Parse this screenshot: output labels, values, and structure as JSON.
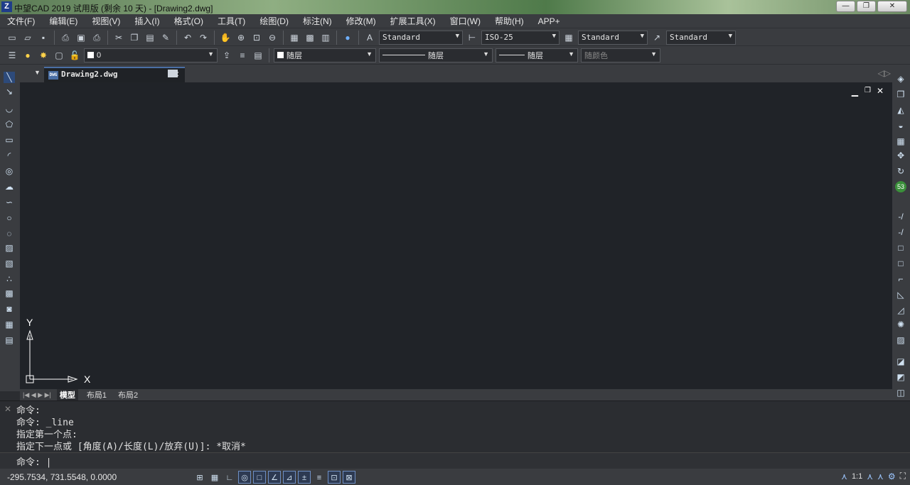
{
  "window": {
    "title": "中望CAD 2019 试用版 (剩余 10 天) - [Drawing2.dwg]",
    "minimize": "—",
    "maximize": "❐",
    "close": "✕"
  },
  "menu": [
    "文件(F)",
    "编辑(E)",
    "视图(V)",
    "插入(I)",
    "格式(O)",
    "工具(T)",
    "绘图(D)",
    "标注(N)",
    "修改(M)",
    "扩展工具(X)",
    "窗口(W)",
    "帮助(H)",
    "APP+"
  ],
  "toolbar1": {
    "text_style": "Standard",
    "dim_style": "ISO-25",
    "table_style": "Standard",
    "multileader_style": "Standard"
  },
  "toolbar2": {
    "layer": "0",
    "color": "随层",
    "linetype": "随层",
    "lineweight": "随层",
    "plotstyle": "随颜色"
  },
  "tab": {
    "filename": "Drawing2.dwg",
    "close": "✕"
  },
  "ucs": {
    "x": "X",
    "y": "Y"
  },
  "layout_tabs": [
    "模型",
    "布局1",
    "布局2"
  ],
  "command_history": [
    "命令:",
    "命令: _line",
    "指定第一个点:",
    "指定下一点或 [角度(A)/长度(L)/放弃(U)]: *取消*"
  ],
  "command_prompt": "命令: |",
  "status": {
    "coordinates": "-295.7534, 731.5548, 0.0000",
    "annotation_scale": "1:1"
  },
  "colors": {
    "canvas": "#202328",
    "ui_bg": "#3a3c40",
    "accent": "#4a6fa5"
  }
}
